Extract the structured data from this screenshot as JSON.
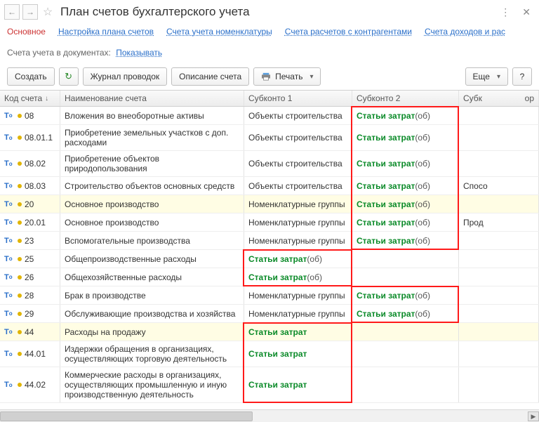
{
  "header": {
    "title": "План счетов бухгалтерского учета"
  },
  "tabs": {
    "active": "Основное",
    "links": [
      "Настройка плана счетов",
      "Счета учета номенклатуры",
      "Счета расчетов с контрагентами",
      "Счета доходов и рас"
    ]
  },
  "docrow": {
    "label": "Счета учета в документах:",
    "link": "Показывать"
  },
  "toolbar": {
    "create": "Создать",
    "journal": "Журнал проводок",
    "desc": "Описание счета",
    "print": "Печать",
    "more": "Еще"
  },
  "columns": {
    "code": "Код счета",
    "name": "Наименование счета",
    "s1": "Субконто 1",
    "s2": "Субконто 2",
    "s3_left": "Субк",
    "s3_right": "ор"
  },
  "sz": "Статьи затрат",
  "ob": "(об)",
  "rows": [
    {
      "hl": false,
      "code": "08",
      "name": "Вложения во внеоборотные активы",
      "s1": "Объекты строительства",
      "s2": {
        "sz": true,
        "ob": true
      },
      "s3": ""
    },
    {
      "hl": false,
      "code": "08.01.1",
      "name": "Приобретение земельных участков с доп. расходами",
      "s1": "Объекты строительства",
      "s2": {
        "sz": true,
        "ob": true
      },
      "s3": ""
    },
    {
      "hl": false,
      "code": "08.02",
      "name": "Приобретение объектов природопользования",
      "s1": "Объекты строительства",
      "s2": {
        "sz": true,
        "ob": true
      },
      "s3": ""
    },
    {
      "hl": false,
      "code": "08.03",
      "name": "Строительство объектов основных средств",
      "s1": "Объекты строительства",
      "s2": {
        "sz": true,
        "ob": true
      },
      "s3": "Спосо"
    },
    {
      "hl": true,
      "code": "20",
      "name": "Основное производство",
      "s1": "Номенклатурные группы",
      "s2": {
        "sz": true,
        "ob": true
      },
      "s3": ""
    },
    {
      "hl": false,
      "code": "20.01",
      "name": "Основное производство",
      "s1": "Номенклатурные группы",
      "s2": {
        "sz": true,
        "ob": true
      },
      "s3": "Прод"
    },
    {
      "hl": false,
      "code": "23",
      "name": "Вспомогательные производства",
      "s1": "Номенклатурные группы",
      "s2": {
        "sz": true,
        "ob": true
      },
      "s3": ""
    },
    {
      "hl": false,
      "code": "25",
      "name": "Общепроизводственные расходы",
      "s1": {
        "sz": true,
        "ob": true
      },
      "s2": null,
      "s3": ""
    },
    {
      "hl": false,
      "code": "26",
      "name": "Общехозяйственные расходы",
      "s1": {
        "sz": true,
        "ob": true
      },
      "s2": null,
      "s3": ""
    },
    {
      "hl": false,
      "code": "28",
      "name": "Брак в производстве",
      "s1": "Номенклатурные группы",
      "s2": {
        "sz": true,
        "ob": true
      },
      "s3": ""
    },
    {
      "hl": false,
      "code": "29",
      "name": "Обслуживающие производства и хозяйства",
      "s1": "Номенклатурные группы",
      "s2": {
        "sz": true,
        "ob": true
      },
      "s3": ""
    },
    {
      "hl": true,
      "code": "44",
      "name": "Расходы на продажу",
      "s1": {
        "sz": true,
        "ob": false
      },
      "s2": null,
      "s3": ""
    },
    {
      "hl": false,
      "code": "44.01",
      "name": "Издержки обращения в организациях, осуществляющих торговую деятельность",
      "s1": {
        "sz": true,
        "ob": false
      },
      "s2": null,
      "s3": ""
    },
    {
      "hl": false,
      "code": "44.02",
      "name": "Коммерческие расходы в организациях, осуществляющих промышленную и иную производственную деятельность",
      "s1": {
        "sz": true,
        "ob": false
      },
      "s2": null,
      "s3": ""
    }
  ],
  "highlights": [
    {
      "col": "s2",
      "rowStart": 0,
      "rowEnd": 6
    },
    {
      "col": "s1",
      "rowStart": 7,
      "rowEnd": 8
    },
    {
      "col": "s2",
      "rowStart": 9,
      "rowEnd": 10
    },
    {
      "col": "s1",
      "rowStart": 11,
      "rowEnd": 13
    }
  ]
}
